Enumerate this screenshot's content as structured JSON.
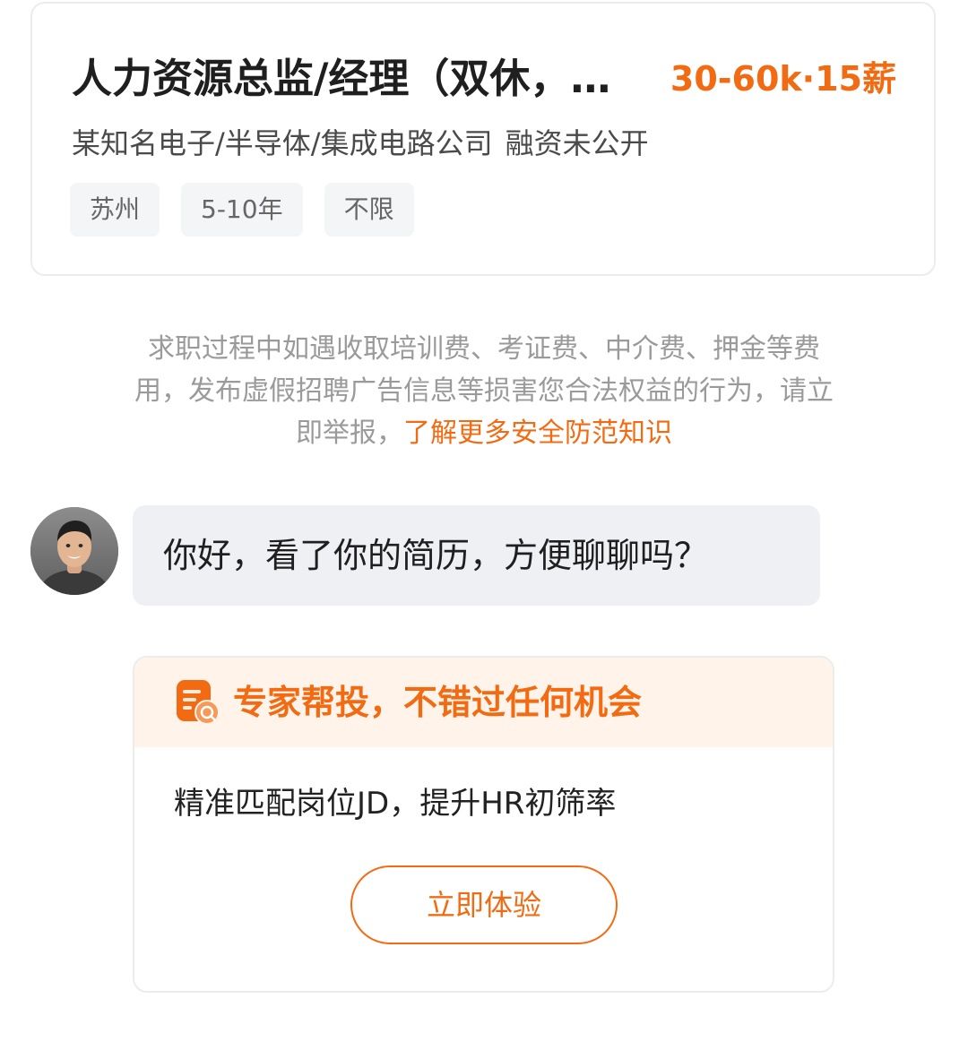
{
  "job": {
    "title": "人力资源总监/经理（双休，…",
    "salary": "30-60k·15薪",
    "company": "某知名电子/半导体/集成电路公司",
    "funding": "融资未公开",
    "tags": [
      "苏州",
      "5-10年",
      "不限"
    ]
  },
  "notice": {
    "text": "求职过程中如遇收取培训费、考证费、中介费、押金等费用，发布虚假招聘广告信息等损害您合法权益的行为，请立即举报，",
    "link_label": "了解更多安全防范知识"
  },
  "chat": {
    "message": "你好，看了你的简历，方便聊聊吗？",
    "avatar_icon": "person-avatar"
  },
  "promo": {
    "icon": "resume-delivery-icon",
    "title": "专家帮投，不错过任何机会",
    "description": "精准匹配岗位JD，提升HR初筛率",
    "button_label": "立即体验"
  },
  "colors": {
    "accent": "#f26b12",
    "tag_background": "#f4f5f7",
    "bubble_background": "#eef0f4",
    "promo_header_background": "#fff3ea"
  }
}
